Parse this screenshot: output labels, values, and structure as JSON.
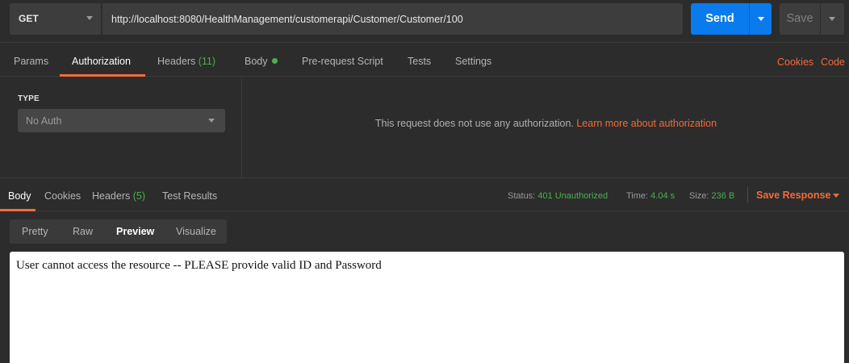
{
  "request": {
    "method": "GET",
    "url": "http://localhost:8080/HealthManagement/customerapi/Customer/Customer/100",
    "send_label": "Send",
    "save_label": "Save"
  },
  "request_tabs": [
    {
      "label": "Params"
    },
    {
      "label": "Authorization",
      "active": true
    },
    {
      "label": "Headers",
      "count": "(11)"
    },
    {
      "label": "Body"
    },
    {
      "label": "Pre-request Script"
    },
    {
      "label": "Tests"
    },
    {
      "label": "Settings"
    }
  ],
  "right_links": {
    "cookies": "Cookies",
    "code": "Code"
  },
  "auth": {
    "type_label": "TYPE",
    "type_value": "No Auth",
    "message": "This request does not use any authorization.",
    "learn_more": "Learn more about authorization"
  },
  "response_tabs": [
    {
      "label": "Body",
      "active": true
    },
    {
      "label": "Cookies"
    },
    {
      "label": "Headers",
      "count": "(5)"
    },
    {
      "label": "Test Results"
    }
  ],
  "response_meta": {
    "status_label": "Status:",
    "status_value": "401 Unauthorized",
    "time_label": "Time:",
    "time_value": "4.04 s",
    "size_label": "Size:",
    "size_value": "236 B",
    "save_response": "Save Response"
  },
  "view_modes": [
    {
      "label": "Pretty"
    },
    {
      "label": "Raw"
    },
    {
      "label": "Preview",
      "active": true
    },
    {
      "label": "Visualize"
    }
  ],
  "preview_text": "User cannot access the resource -- PLEASE provide valid ID and Password",
  "colors": {
    "accent": "#f26b3a",
    "send_blue": "#097bed",
    "success_green": "#4caf50",
    "background": "#2c2c2c"
  }
}
